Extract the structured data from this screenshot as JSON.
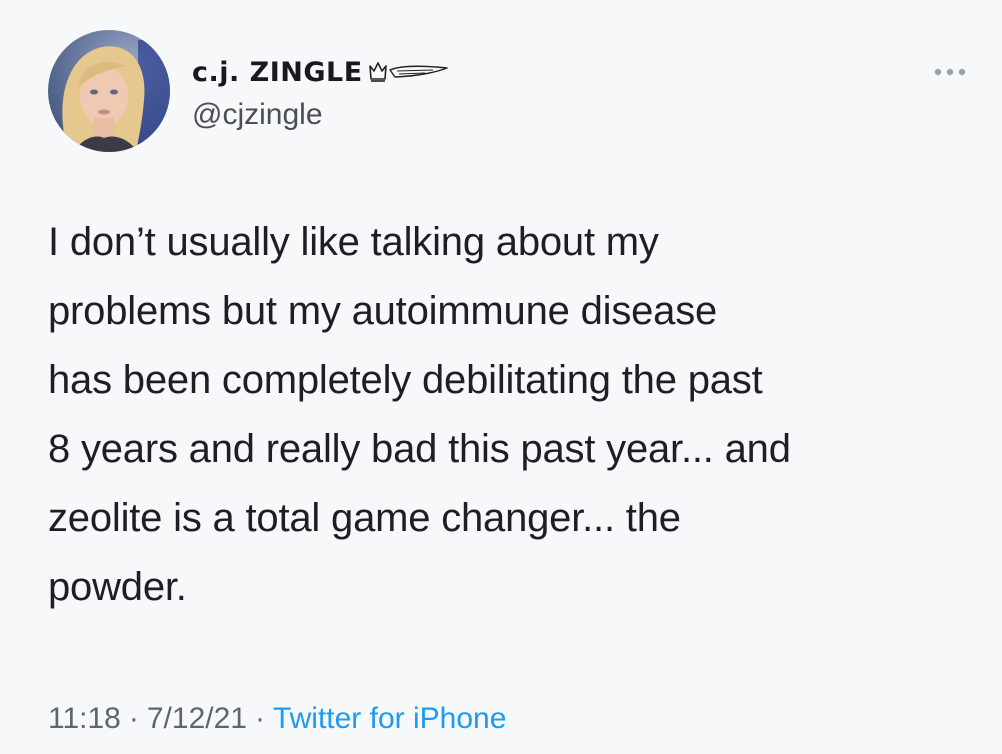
{
  "tweet": {
    "user": {
      "display_name": "c.j. ZINGLE",
      "handle": "@cjzingle",
      "avatar_icon": "profile-photo",
      "name_emojis": [
        "crown-emoji",
        "wing-emoji"
      ]
    },
    "more_icon": "more-dots-icon",
    "text": "I don’t usually like talking about my\nproblems but my autoimmune disease\nhas been completely debilitating the past\n8 years and really bad this past year... and\nzeolite is a total game changer... the\npowder.",
    "time": "11:18",
    "separator": "·",
    "date": "7/12/21",
    "source": "Twitter for iPhone"
  },
  "colors": {
    "background": "#f7f8fa",
    "text": "#1c1f23",
    "secondary_text": "#5d6670",
    "link": "#1d9bf0"
  }
}
